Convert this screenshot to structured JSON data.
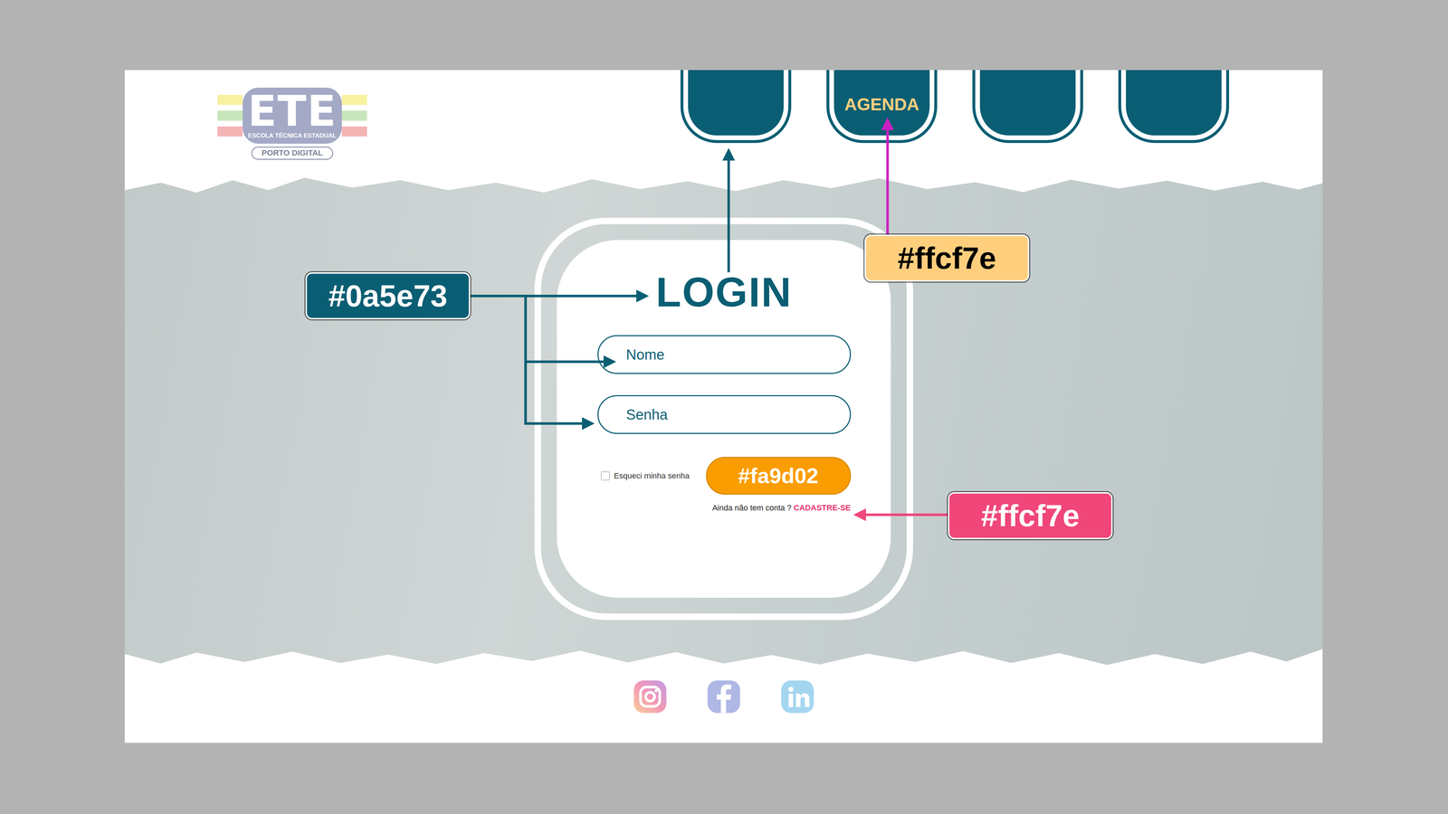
{
  "logo": {
    "title": "ETE",
    "subtitle": "ESCOLA TÉCNICA ESTADUAL",
    "tagline": "PORTO DIGITAL"
  },
  "nav": {
    "tabs": [
      {
        "label": ""
      },
      {
        "label": "AGENDA"
      },
      {
        "label": ""
      },
      {
        "label": ""
      }
    ]
  },
  "login": {
    "title": "LOGIN",
    "fields": [
      {
        "placeholder": "Nome",
        "kind": "text"
      },
      {
        "placeholder": "Senha",
        "kind": "password"
      }
    ],
    "remember": {
      "label": "Esqueci minha senha",
      "checked": false
    },
    "submit": "#fa9d02",
    "signup_prompt": "Ainda não tem conta ?",
    "signup_link": "CADASTRE-SE"
  },
  "annotations": [
    {
      "label": "#0a5e73",
      "color": "#0a5e73",
      "arrow_color": "#0a5e73"
    },
    {
      "label": "#ffcf7e",
      "color": "#ffcf7e",
      "arrow_color": "#cc1fc4"
    },
    {
      "label": "#ffcf7e",
      "color": "#f0467a",
      "arrow_color": "#f0467a"
    }
  ]
}
